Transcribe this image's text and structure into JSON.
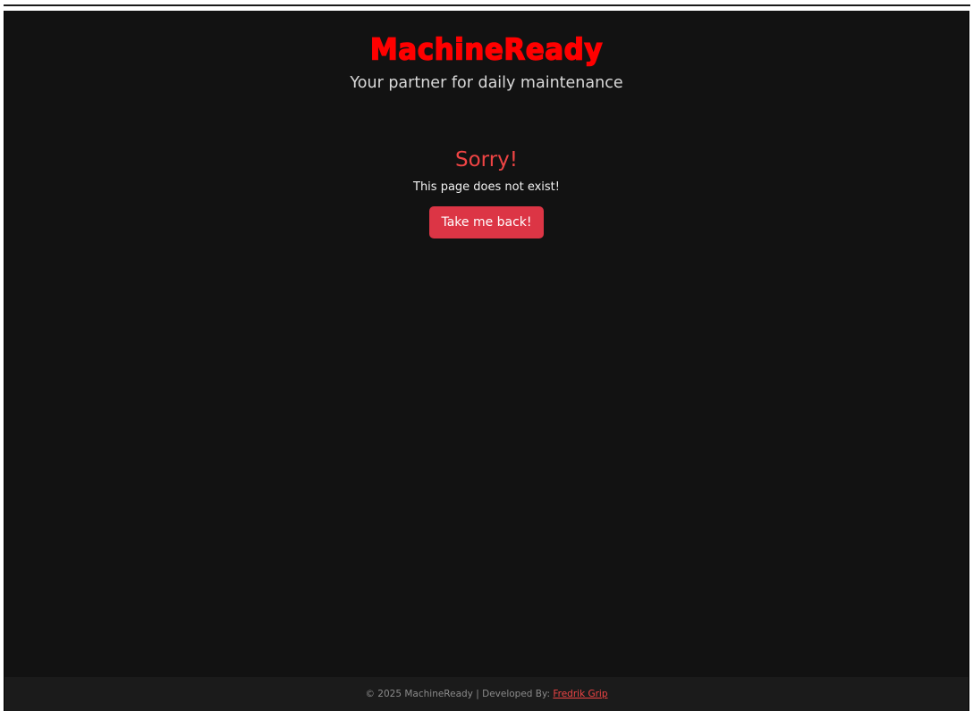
{
  "header": {
    "brand": "MachineReady",
    "tagline": "Your partner for daily maintenance"
  },
  "error": {
    "heading": "Sorry!",
    "message": "This page does not exist!",
    "back_button_label": "Take me back!"
  },
  "footer": {
    "copyright": "© 2025 MachineReady | Developed By:",
    "developer_link": "Fredrik Grip"
  },
  "colors": {
    "background": "#121212",
    "brand": "#ff0000",
    "accent": "#dc3545",
    "heading": "#ef4444"
  }
}
